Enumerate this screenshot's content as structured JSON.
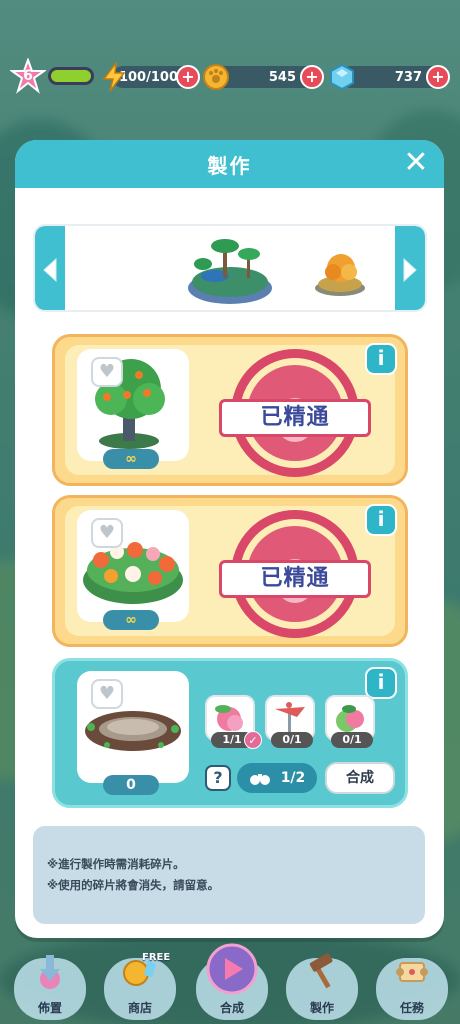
{
  "hud": {
    "level": "6",
    "xp_progress": 1.0,
    "energy": "100/100",
    "coins": "545",
    "gems": "737"
  },
  "panel": {
    "title": "製作",
    "close_icon": "✕"
  },
  "carousel": {
    "prev_icon": "chevron-left-icon",
    "next_icon": "chevron-right-icon",
    "items": [
      "island-tropical-icon",
      "autumn-tree-icon"
    ]
  },
  "recipes": [
    {
      "item": "orange-tree",
      "quantity": "∞",
      "status": "已精通"
    },
    {
      "item": "flower-bush",
      "quantity": "∞",
      "status": "已精通"
    },
    {
      "item": "mud-pond",
      "quantity": "0",
      "materials": [
        {
          "item": "pink-fruit-piece",
          "count": "1/1",
          "complete": true
        },
        {
          "item": "weather-vane-piece",
          "count": "0/1",
          "complete": false
        },
        {
          "item": "green-fruit-piece",
          "count": "0/1",
          "complete": false
        }
      ],
      "help": "?",
      "progress": "1/2",
      "craft_label": "合成"
    }
  ],
  "note": {
    "line1": "※進行製作時需消耗碎片。",
    "line2": "※使用的碎片將會消失，請留意。"
  },
  "nav": {
    "items": [
      {
        "label": "佈置"
      },
      {
        "label": "商店",
        "tag": "FREE"
      },
      {
        "label": "合成"
      },
      {
        "label": "製作"
      },
      {
        "label": "任務"
      }
    ]
  },
  "colors": {
    "header": "#3fbfcf",
    "stamp": "#d94868",
    "mastered_card": "#fdd98c",
    "active_card": "#59c9cf"
  }
}
